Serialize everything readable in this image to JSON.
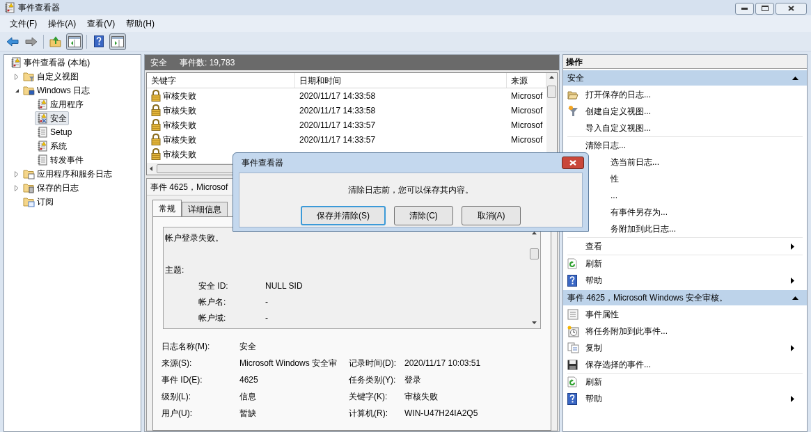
{
  "window": {
    "title": "事件查看器"
  },
  "menu": [
    "文件(F)",
    "操作(A)",
    "查看(V)",
    "帮助(H)"
  ],
  "toolbar": [
    {
      "pressed": false
    },
    {
      "pressed": false
    },
    {
      "pressed": false
    },
    {
      "pressed": true
    },
    {
      "pressed": false
    },
    {
      "pressed": true
    }
  ],
  "tree": [
    {
      "label": "事件查看器 (本地)",
      "selected": false,
      "children": [
        {
          "label": "自定义视图",
          "selected": false,
          "expanded": false
        },
        {
          "label": "Windows 日志",
          "selected": false,
          "expanded": true,
          "children": [
            {
              "label": "应用程序",
              "selected": false
            },
            {
              "label": "安全",
              "selected": true
            },
            {
              "label": "Setup",
              "selected": false
            },
            {
              "label": "系统",
              "selected": false
            },
            {
              "label": "转发事件",
              "selected": false
            }
          ]
        },
        {
          "label": "应用程序和服务日志",
          "selected": false,
          "expanded": false
        },
        {
          "label": "保存的日志",
          "selected": false,
          "expanded": false
        },
        {
          "label": "订阅",
          "selected": false
        }
      ]
    }
  ],
  "log_header": {
    "name": "安全",
    "count": "事件数: 19,783"
  },
  "table": {
    "columns": [
      "关键字",
      "日期和时间",
      "来源"
    ],
    "rows": [
      {
        "keyword": "审核失败",
        "datetime": "2020/11/17 14:33:58",
        "source": "Microsof"
      },
      {
        "keyword": "审核失败",
        "datetime": "2020/11/17 14:33:58",
        "source": "Microsof"
      },
      {
        "keyword": "审核失败",
        "datetime": "2020/11/17 14:33:57",
        "source": "Microsof"
      },
      {
        "keyword": "审核失败",
        "datetime": "2020/11/17 14:33:57",
        "source": "Microsof"
      },
      {
        "keyword": "审核失败"
      }
    ]
  },
  "detail": {
    "title": "事件 4625，Microsof",
    "tabs": [
      {
        "label": "常规",
        "selected": true
      },
      {
        "label": "详细信息",
        "selected": false
      }
    ],
    "description": {
      "summary": "帐户登录失败。",
      "section": "主题:",
      "fields": [
        {
          "label": "安全 ID:",
          "value": "NULL SID"
        },
        {
          "label": "帐户名:",
          "value": "-"
        },
        {
          "label": "帐户域:",
          "value": "-"
        }
      ]
    },
    "properties": [
      {
        "label": "日志名称(M):",
        "value": "安全"
      },
      {
        "label": "来源(S):",
        "value": "Microsoft Windows 安全审",
        "label2": "记录时间(D):",
        "value2": "2020/11/17 10:03:51"
      },
      {
        "label": "事件 ID(E):",
        "value": "4625",
        "label2": "任务类别(Y):",
        "value2": "登录"
      },
      {
        "label": "级别(L):",
        "value": "信息",
        "label2": "关键字(K):",
        "value2": "审核失败"
      },
      {
        "label": "用户(U):",
        "value": "暂缺",
        "label2": "计算机(R):",
        "value2": "WIN-U47H24IA2Q5"
      }
    ]
  },
  "actions": {
    "title": "操作",
    "sections": [
      {
        "title": "安全",
        "expanded": true,
        "groups": [
          [
            {
              "label": "打开保存的日志...",
              "submenu": false,
              "kind": "action"
            },
            {
              "label": "创建自定义视图...",
              "submenu": false,
              "kind": "action"
            },
            {
              "label": "导入自定义视图...",
              "submenu": false,
              "kind": "action"
            }
          ],
          [
            {
              "label": "清除日志...",
              "submenu": false,
              "kind": "action"
            },
            {
              "label": "选当前日志...",
              "submenu": false,
              "kind": "covered"
            },
            {
              "label": "性",
              "submenu": false,
              "kind": "covered"
            },
            {
              "label": "...",
              "submenu": false,
              "kind": "covered"
            },
            {
              "label": "有事件另存为...",
              "submenu": false,
              "kind": "covered"
            },
            {
              "label": "务附加到此日志...",
              "submenu": false,
              "kind": "covered"
            }
          ],
          [
            {
              "label": "查看",
              "submenu": true,
              "kind": "action"
            }
          ],
          [
            {
              "label": "刷新",
              "submenu": false,
              "kind": "action"
            },
            {
              "label": "帮助",
              "submenu": true,
              "kind": "action"
            }
          ]
        ]
      },
      {
        "title": "事件 4625，Microsoft Windows 安全审核。",
        "expanded": true,
        "groups": [
          [
            {
              "label": "事件属性",
              "submenu": false,
              "kind": "action"
            },
            {
              "label": "将任务附加到此事件...",
              "submenu": false,
              "kind": "action"
            },
            {
              "label": "复制",
              "submenu": true,
              "kind": "action"
            },
            {
              "label": "保存选择的事件...",
              "submenu": false,
              "kind": "action"
            }
          ],
          [
            {
              "label": "刷新",
              "submenu": false,
              "kind": "action"
            },
            {
              "label": "帮助",
              "submenu": true,
              "kind": "action"
            }
          ]
        ]
      }
    ]
  },
  "dialog": {
    "title": "事件查看器",
    "message": "清除日志前，您可以保存其内容。",
    "buttons": [
      {
        "label": "保存并清除(S)",
        "default": true
      },
      {
        "label": "清除(C)",
        "default": false
      },
      {
        "label": "取消(A)",
        "default": false
      }
    ]
  }
}
